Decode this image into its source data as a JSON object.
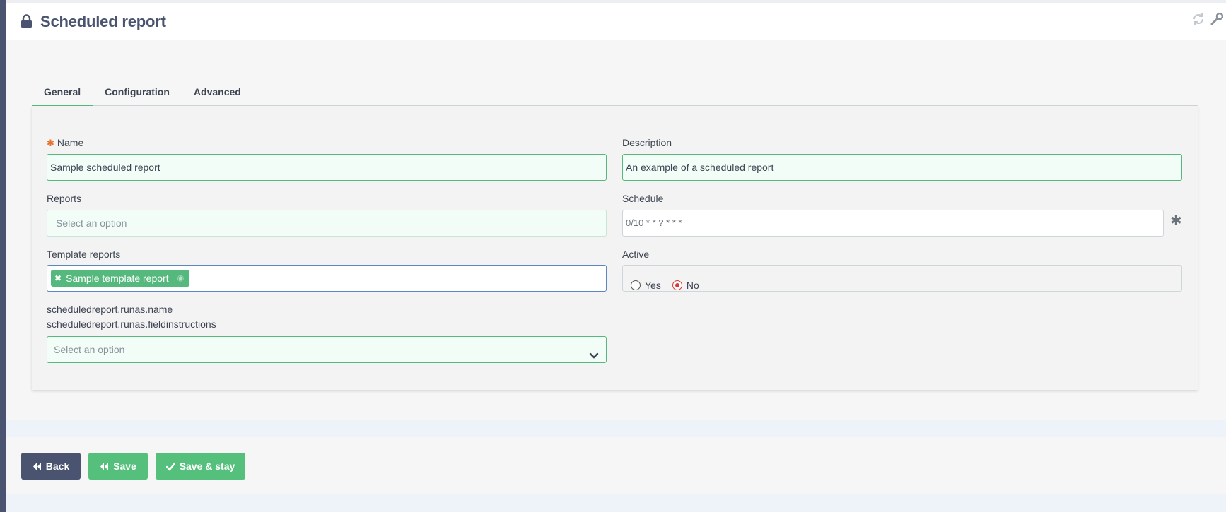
{
  "header": {
    "title": "Scheduled report"
  },
  "tabs": [
    {
      "label": "General",
      "active": true
    },
    {
      "label": "Configuration",
      "active": false
    },
    {
      "label": "Advanced",
      "active": false
    }
  ],
  "form": {
    "name": {
      "label": "Name",
      "required_mark": "✱",
      "value": "Sample scheduled report"
    },
    "description": {
      "label": "Description",
      "value": "An example of a scheduled report"
    },
    "reports": {
      "label": "Reports",
      "placeholder": "Select an option"
    },
    "schedule": {
      "label": "Schedule",
      "value": "0/10 * * ? * * *",
      "side_icon": "✱"
    },
    "template_reports": {
      "label": "Template reports",
      "tag": "Sample template report"
    },
    "active": {
      "label": "Active",
      "yes": "Yes",
      "no": "No",
      "selected": "No"
    },
    "runas": {
      "label": "scheduledreport.runas.name",
      "instructions": "scheduledreport.runas.fieldinstructions",
      "placeholder": "Select an option"
    }
  },
  "buttons": {
    "back": "Back",
    "save": "Save",
    "save_stay": "Save & stay"
  },
  "colors": {
    "accent": "#55c07c",
    "dark": "#4a5470",
    "required": "#e8742b"
  }
}
